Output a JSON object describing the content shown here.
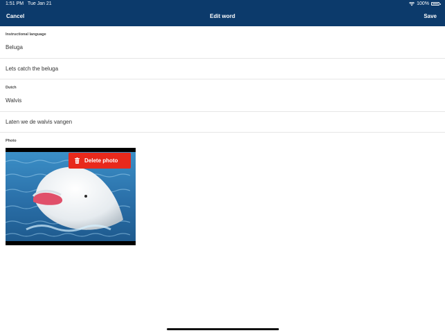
{
  "status_bar": {
    "time": "1:51 PM",
    "date": "Tue Jan 21",
    "battery": "100%"
  },
  "nav": {
    "cancel_label": "Cancel",
    "title": "Edit word",
    "save_label": "Save"
  },
  "instructional": {
    "label": "Instructional language",
    "word": "Beluga",
    "sentence": "Lets catch the beluga"
  },
  "dutch": {
    "label": "Dutch",
    "word": "Walvis",
    "sentence": "Laten we de walvis vangen"
  },
  "photo": {
    "label": "Photo",
    "delete_label": "Delete photo",
    "icon": "trash-icon"
  },
  "colors": {
    "nav": "#0c3a6b",
    "delete": "#e8291c"
  }
}
